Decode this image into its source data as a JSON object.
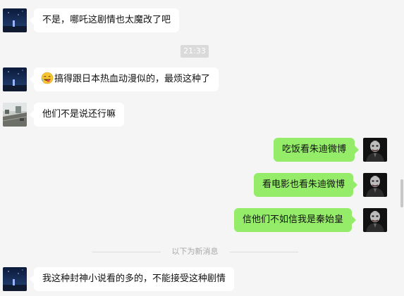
{
  "messages": [
    {
      "sender": "left",
      "avatar": "night-sky-avatar",
      "text": "不是，哪吒这剧情也太魔改了吧"
    },
    {
      "timestamp": "21:33"
    },
    {
      "sender": "left",
      "avatar": "night-sky-avatar",
      "emoji": "face-with-tongue-emoji",
      "text": "搞得跟日本热血动漫似的，最烦这种了"
    },
    {
      "sender": "left",
      "avatar": "street-scene-avatar",
      "text": "他们不是说还行嘛"
    },
    {
      "sender": "right",
      "avatar": "dark-figure-avatar",
      "text": "吃饭看朱迪微博"
    },
    {
      "sender": "right",
      "avatar": "dark-figure-avatar",
      "text": "看电影也看朱迪微博"
    },
    {
      "sender": "right",
      "avatar": "dark-figure-avatar",
      "text": "信他们不如信我是秦始皇"
    },
    {
      "divider": "以下为新消息"
    },
    {
      "sender": "left",
      "avatar": "night-sky-avatar",
      "text": "我这种封神小说看的多的，不能接受这种剧情"
    }
  ],
  "colors": {
    "background": "#f5f5f5",
    "incoming_bubble": "#ffffff",
    "outgoing_bubble": "#95ec69",
    "timestamp_pill": "#dadada",
    "divider_text": "#a9a9a9"
  }
}
